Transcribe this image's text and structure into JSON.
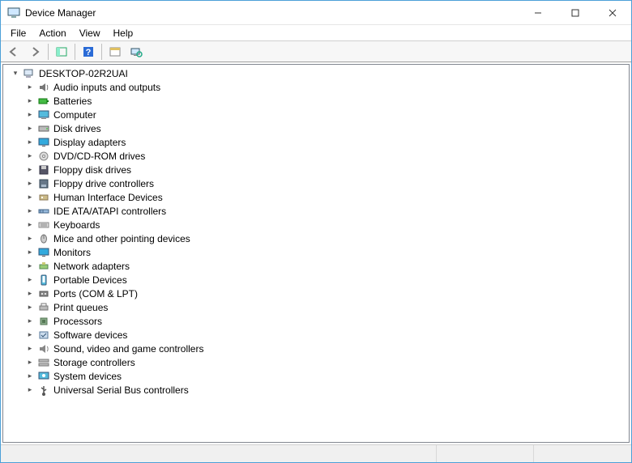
{
  "window": {
    "title": "Device Manager"
  },
  "menu": {
    "file": "File",
    "action": "Action",
    "view": "View",
    "help": "Help"
  },
  "tree": {
    "root": {
      "label": "DESKTOP-02R2UAI",
      "expanded": true,
      "icon": "computer-root-icon"
    },
    "categories": [
      {
        "label": "Audio inputs and outputs",
        "icon": "audio-icon"
      },
      {
        "label": "Batteries",
        "icon": "battery-icon"
      },
      {
        "label": "Computer",
        "icon": "computer-icon"
      },
      {
        "label": "Disk drives",
        "icon": "disk-icon"
      },
      {
        "label": "Display adapters",
        "icon": "display-icon"
      },
      {
        "label": "DVD/CD-ROM drives",
        "icon": "optical-icon"
      },
      {
        "label": "Floppy disk drives",
        "icon": "floppy-icon"
      },
      {
        "label": "Floppy drive controllers",
        "icon": "floppy-ctrl-icon"
      },
      {
        "label": "Human Interface Devices",
        "icon": "hid-icon"
      },
      {
        "label": "IDE ATA/ATAPI controllers",
        "icon": "ide-icon"
      },
      {
        "label": "Keyboards",
        "icon": "keyboard-icon"
      },
      {
        "label": "Mice and other pointing devices",
        "icon": "mouse-icon"
      },
      {
        "label": "Monitors",
        "icon": "monitor-icon"
      },
      {
        "label": "Network adapters",
        "icon": "network-icon"
      },
      {
        "label": "Portable Devices",
        "icon": "portable-icon"
      },
      {
        "label": "Ports (COM & LPT)",
        "icon": "ports-icon"
      },
      {
        "label": "Print queues",
        "icon": "printer-icon"
      },
      {
        "label": "Processors",
        "icon": "cpu-icon"
      },
      {
        "label": "Software devices",
        "icon": "software-icon"
      },
      {
        "label": "Sound, video and game controllers",
        "icon": "sound-icon"
      },
      {
        "label": "Storage controllers",
        "icon": "storage-icon"
      },
      {
        "label": "System devices",
        "icon": "system-icon"
      },
      {
        "label": "Universal Serial Bus controllers",
        "icon": "usb-icon"
      }
    ]
  }
}
